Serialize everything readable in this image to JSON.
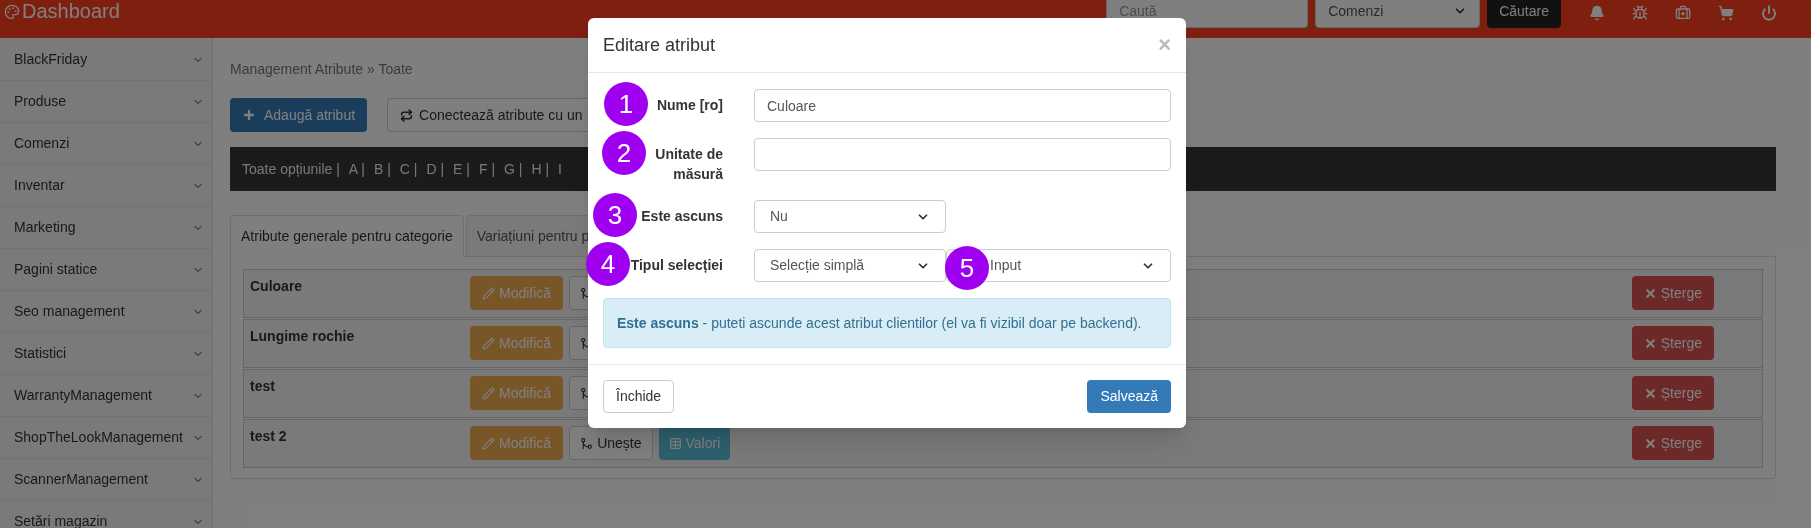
{
  "header": {
    "title": "Dashboard",
    "search": {
      "placeholder": "Caută"
    },
    "search_scope": "Comenzi",
    "search_button": "Căutare"
  },
  "sidebar": {
    "items": [
      {
        "label": "BlackFriday"
      },
      {
        "label": "Produse"
      },
      {
        "label": "Comenzi"
      },
      {
        "label": "Inventar"
      },
      {
        "label": "Marketing"
      },
      {
        "label": "Pagini statice"
      },
      {
        "label": "Seo management"
      },
      {
        "label": "Statistici"
      },
      {
        "label": "WarrantyManagement"
      },
      {
        "label": "ShopTheLookManagement"
      },
      {
        "label": "ScannerManagement"
      },
      {
        "label": "Setări magazin"
      }
    ]
  },
  "breadcrumb": "Management Atribute » Toate",
  "toolbar": {
    "add_button": "Adaugă atribut",
    "connect_button": "Conectează atribute cu un"
  },
  "alphabet": [
    "Toate opțiunile |",
    "A |",
    "B |",
    "C |",
    "D |",
    "E |",
    "F |",
    "G |",
    "H |",
    "I"
  ],
  "tabs": [
    {
      "label": "Atribute generale pentru categorie",
      "selected": true
    },
    {
      "label": "Variațiuni pentru p",
      "selected": false
    }
  ],
  "rows": [
    {
      "name": "Culoare",
      "buttons": [
        {
          "kind": "modify",
          "label": "Modifică"
        },
        {
          "kind": "merge"
        },
        {
          "kind": "delete",
          "label": "Șterge"
        }
      ]
    },
    {
      "name": "Lungime rochie",
      "buttons": [
        {
          "kind": "modify",
          "label": "Modifică"
        },
        {
          "kind": "merge"
        },
        {
          "kind": "delete",
          "label": "Șterge"
        }
      ]
    },
    {
      "name": "test",
      "buttons": [
        {
          "kind": "modify",
          "label": "Modifică"
        },
        {
          "kind": "merge"
        },
        {
          "kind": "delete",
          "label": "Șterge"
        }
      ]
    },
    {
      "name": "test 2",
      "buttons": [
        {
          "kind": "modify",
          "label": "Modifică"
        },
        {
          "kind": "merge",
          "label": "Unește"
        },
        {
          "kind": "values",
          "label": "Valori"
        },
        {
          "kind": "delete",
          "label": "Șterge"
        }
      ]
    }
  ],
  "modal": {
    "title": "Editare atribut",
    "close": "×",
    "fields": [
      {
        "marker": "1",
        "label": "Nume [ro]",
        "kind": "input",
        "value": "Culoare"
      },
      {
        "marker": "2",
        "label": "Unitate de măsură",
        "kind": "input"
      },
      {
        "marker": "3",
        "label": "Este ascuns",
        "kind": "select",
        "value": "Nu"
      },
      {
        "marker": "4",
        "label": "Tipul selecției",
        "kind": "select_pair",
        "value": "Selecție simplă",
        "second": {
          "marker": "5",
          "value": "Input"
        }
      }
    ],
    "info": "**Este ascuns** - puteti ascunde acest atribut clientilor (el va fi vizibil doar pe backend).",
    "close_button": "Închide",
    "save_button": "Salvează"
  }
}
